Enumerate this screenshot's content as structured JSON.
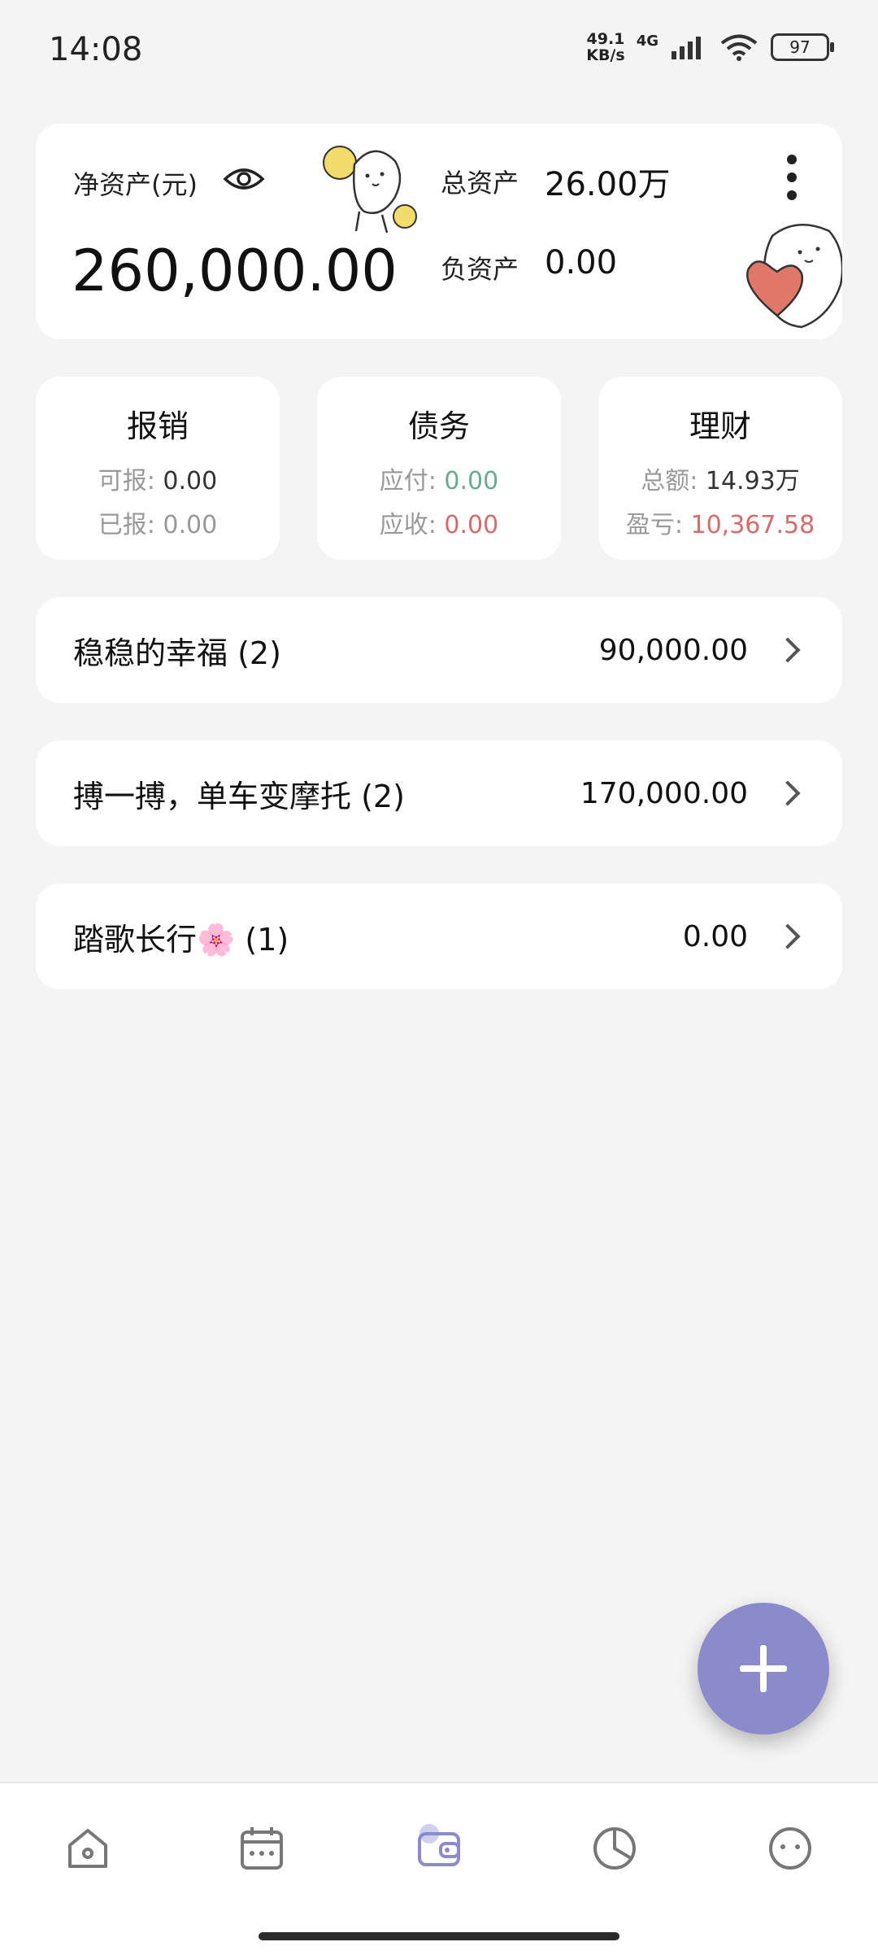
{
  "status_bar": {
    "time": "14:08",
    "net_speed_value": "49.1",
    "net_speed_unit": "KB/s",
    "signal_type": "4G",
    "battery": "97"
  },
  "summary": {
    "net_assets_label": "净资产(元)",
    "net_assets_value": "260,000.00",
    "total_assets_label": "总资产",
    "total_assets_value": "26.00万",
    "liabilities_label": "负资产",
    "liabilities_value": "0.00"
  },
  "mini_cards": {
    "reimburse": {
      "title": "报销",
      "row1_label": "可报:",
      "row1_value": "0.00",
      "row2_label": "已报:",
      "row2_value": "0.00"
    },
    "debt": {
      "title": "债务",
      "row1_label": "应付:",
      "row1_value": "0.00",
      "row2_label": "应收:",
      "row2_value": "0.00"
    },
    "finance": {
      "title": "理财",
      "row1_label": "总额:",
      "row1_value": "14.93万",
      "row2_label": "盈亏:",
      "row2_value": "10,367.58"
    }
  },
  "accounts": [
    {
      "name": "稳稳的幸福 (2)",
      "amount": "90,000.00"
    },
    {
      "name": "搏一搏，单车变摩托 (2)",
      "amount": "170,000.00"
    },
    {
      "name": "踏歌长行🌸 (1)",
      "amount": "0.00"
    }
  ],
  "colors": {
    "accent": "#8b8bcb",
    "positive": "#6aab8e",
    "negative": "#d96a6a"
  },
  "nav": [
    "home-icon",
    "calendar-icon",
    "wallet-icon",
    "pie-chart-icon",
    "smiley-icon"
  ]
}
